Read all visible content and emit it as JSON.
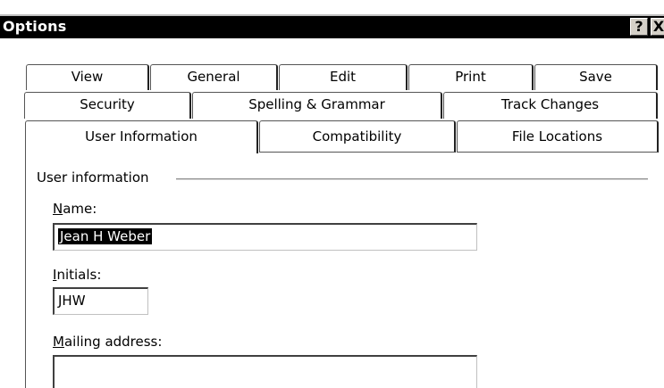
{
  "window": {
    "title": "Options",
    "help_button": "?",
    "close_button": "X"
  },
  "tabs": {
    "row1": [
      "View",
      "General",
      "Edit",
      "Print",
      "Save"
    ],
    "row2": [
      "Security",
      "Spelling & Grammar",
      "Track Changes"
    ],
    "row3": [
      "User Information",
      "Compatibility",
      "File Locations"
    ],
    "active": "User Information"
  },
  "user_info": {
    "group_label": "User information",
    "name_label_underlined": "N",
    "name_label_rest": "ame:",
    "name_value": "Jean H Weber",
    "initials_label_underlined": "I",
    "initials_label_rest": "nitials:",
    "initials_value": "JHW",
    "mailing_label_underlined": "M",
    "mailing_label_rest": "ailing address:",
    "mailing_value": ""
  }
}
